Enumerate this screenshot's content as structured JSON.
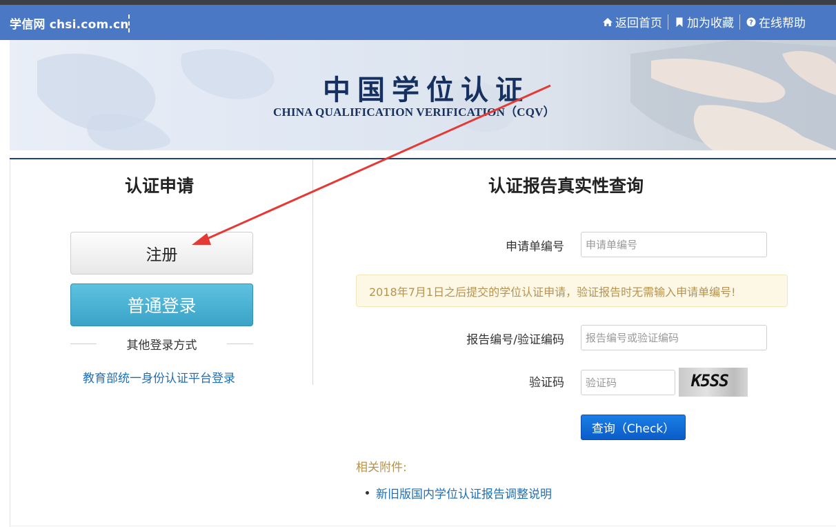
{
  "topbar": {
    "brand": "学信网 chsi.com.cn",
    "links": [
      {
        "label": "返回首页",
        "icon": "home-icon"
      },
      {
        "label": "加为收藏",
        "icon": "bookmark-icon"
      },
      {
        "label": "在线帮助",
        "icon": "help-icon"
      }
    ]
  },
  "banner": {
    "title": "中国学位认证",
    "subtitle": "CHINA QUALIFICATION VERIFICATION（CQV）"
  },
  "left": {
    "heading": "认证申请",
    "register_label": "注册",
    "login_label": "普通登录",
    "other_login_label": "其他登录方式",
    "edu_login_link": "教育部统一身份认证平台登录"
  },
  "right": {
    "heading": "认证报告真实性查询",
    "application_no": {
      "label": "申请单编号",
      "placeholder": "申请单编号"
    },
    "notice": "2018年7月1日之后提交的学位认证申请，验证报告时无需输入申请单编号!",
    "report_no": {
      "label": "报告编号/验证编码",
      "placeholder": "报告编号或验证编码"
    },
    "captcha": {
      "label": "验证码",
      "placeholder": "验证码",
      "image_text": "K5SS"
    },
    "check_label": "查询（Check）",
    "attachments_title": "相关附件:",
    "attachments": [
      "新旧版国内学位认证报告调整说明"
    ]
  },
  "colors": {
    "topbar": "#4a78c4",
    "login_button": "#3aa3c7",
    "check_button": "#0b5cc8",
    "annotation_arrow": "#e53935",
    "notice_text": "#b7924f"
  }
}
